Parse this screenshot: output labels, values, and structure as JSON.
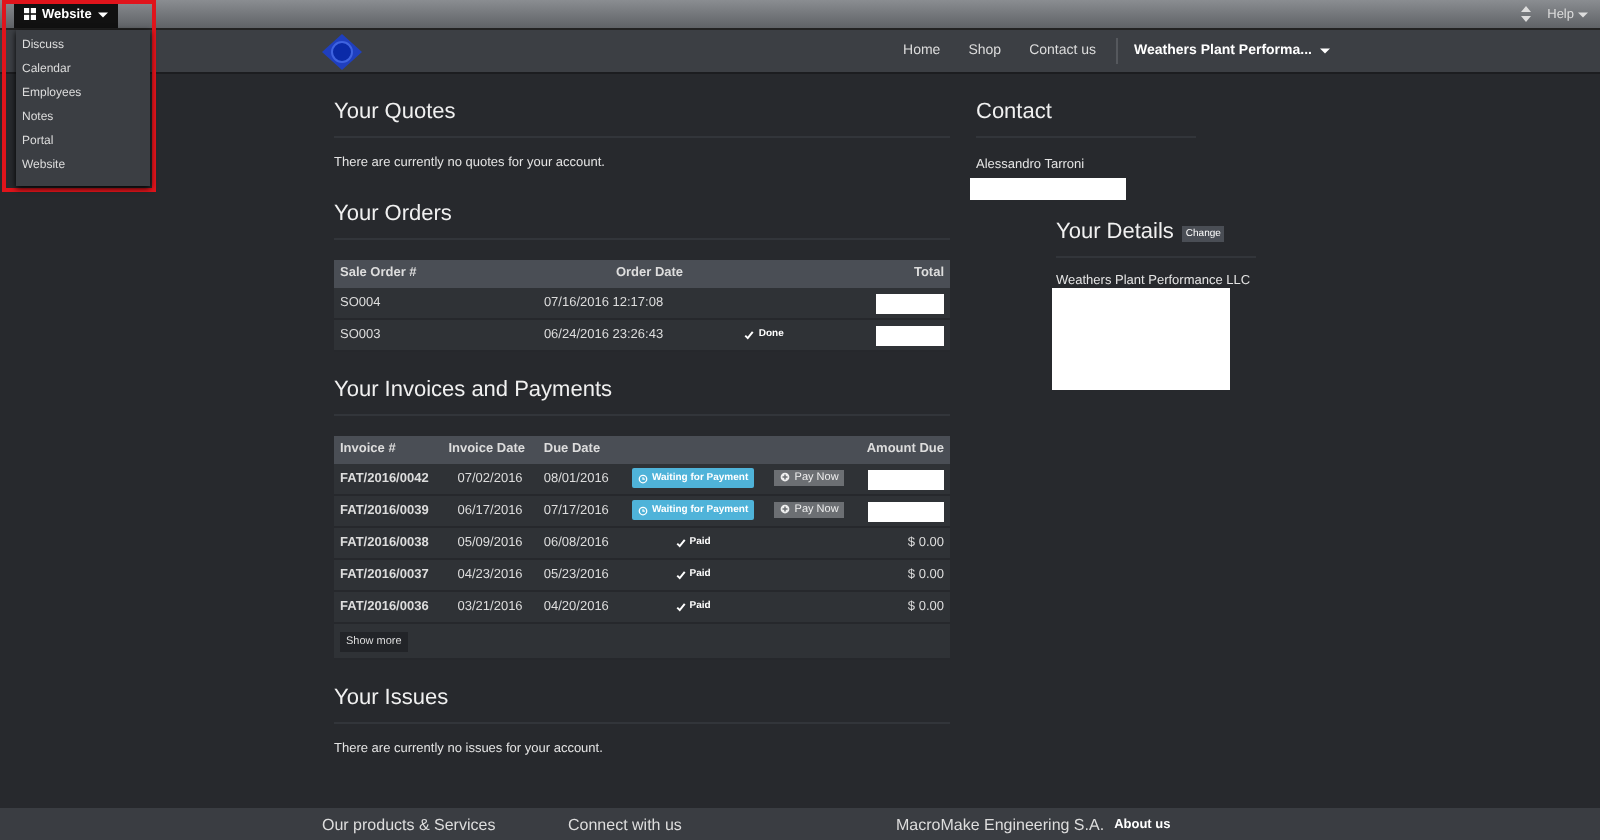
{
  "top_bar": {
    "app_menu": "Website",
    "help": "Help"
  },
  "app_menu_items": [
    "Discuss",
    "Calendar",
    "Employees",
    "Notes",
    "Portal",
    "Website"
  ],
  "navbar": {
    "links": [
      "Home",
      "Shop",
      "Contact us"
    ],
    "user": "Weathers Plant Performa..."
  },
  "quotes": {
    "title": "Your Quotes",
    "empty_text": "There are currently no quotes for your account."
  },
  "orders": {
    "title": "Your Orders",
    "columns": [
      "Sale Order #",
      "Order Date",
      "Total"
    ],
    "rows": [
      {
        "number": "SO004",
        "date": "07/16/2016 12:17:08"
      },
      {
        "number": "SO003",
        "date": "06/24/2016 23:26:43",
        "status": "Done"
      }
    ]
  },
  "invoices": {
    "title": "Your Invoices and Payments",
    "columns": [
      "Invoice #",
      "Invoice Date",
      "Due Date",
      "Amount Due"
    ],
    "rows": [
      {
        "number": "FAT/2016/0042",
        "invoice_date": "07/02/2016",
        "due_date": "08/01/2016",
        "status": {
          "kind": "waiting",
          "label": "Waiting for Payment"
        },
        "action": "Pay Now"
      },
      {
        "number": "FAT/2016/0039",
        "invoice_date": "06/17/2016",
        "due_date": "07/17/2016",
        "status": {
          "kind": "waiting",
          "label": "Waiting for Payment"
        },
        "action": "Pay Now"
      },
      {
        "number": "FAT/2016/0038",
        "invoice_date": "05/09/2016",
        "due_date": "06/08/2016",
        "status": {
          "kind": "paid",
          "label": "Paid"
        },
        "amount": "$ 0.00"
      },
      {
        "number": "FAT/2016/0037",
        "invoice_date": "04/23/2016",
        "due_date": "05/23/2016",
        "status": {
          "kind": "paid",
          "label": "Paid"
        },
        "amount": "$ 0.00"
      },
      {
        "number": "FAT/2016/0036",
        "invoice_date": "03/21/2016",
        "due_date": "04/20/2016",
        "status": {
          "kind": "paid",
          "label": "Paid"
        },
        "amount": "$ 0.00"
      }
    ],
    "show_more": "Show more"
  },
  "issues": {
    "title": "Your Issues",
    "empty_text": "There are currently no issues for your account."
  },
  "contact": {
    "title": "Contact",
    "name": "Alessandro Tarroni"
  },
  "details": {
    "title": "Your Details",
    "change": "Change",
    "company": "Weathers Plant Performance LLC"
  },
  "footer": {
    "products": "Our products & Services",
    "connect": "Connect with us",
    "company": "MacroMake Engineering S.A.",
    "about": "About us"
  }
}
